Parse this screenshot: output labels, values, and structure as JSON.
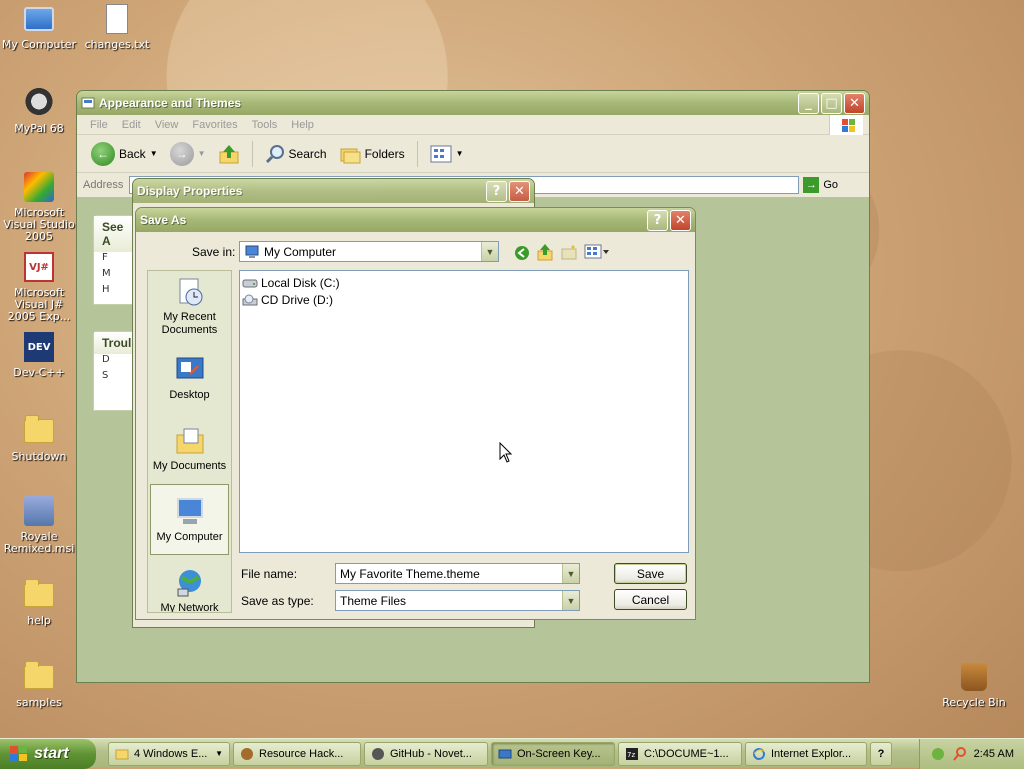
{
  "desktop": {
    "icons": [
      {
        "label": "My Computer",
        "icon": "computer-icon"
      },
      {
        "label": "changes.txt",
        "icon": "text-file-icon"
      },
      {
        "label": "MyPal 68",
        "icon": "browser-icon"
      },
      {
        "label": "Microsoft Visual Studio 2005",
        "icon": "visual-studio-icon"
      },
      {
        "label": "Microsoft Visual J# 2005 Exp...",
        "icon": "visual-j-icon"
      },
      {
        "label": "Dev-C++",
        "icon": "devcpp-icon"
      },
      {
        "label": "Shutdown",
        "icon": "folder-icon"
      },
      {
        "label": "Royale Remixed.msi",
        "icon": "installer-icon"
      },
      {
        "label": "help",
        "icon": "folder-icon"
      },
      {
        "label": "samples",
        "icon": "folder-icon"
      },
      {
        "label": "Recycle Bin",
        "icon": "recycle-bin-icon"
      }
    ]
  },
  "explorer": {
    "title": "Appearance and Themes",
    "menu": [
      "File",
      "Edit",
      "View",
      "Favorites",
      "Tools",
      "Help"
    ],
    "toolbar": {
      "back": "Back",
      "search": "Search",
      "folders": "Folders"
    },
    "address_label": "Address",
    "go_label": "Go",
    "side_panels": [
      {
        "heading": "See A",
        "rows": [
          "F",
          "M",
          "H"
        ]
      },
      {
        "heading": "Troul",
        "rows": [
          "D",
          "S"
        ]
      }
    ]
  },
  "display_properties": {
    "title": "Display Properties"
  },
  "save_as": {
    "title": "Save As",
    "save_in_label": "Save in:",
    "save_in_value": "My Computer",
    "places": [
      {
        "label": "My Recent Documents",
        "icon": "recent-documents-icon"
      },
      {
        "label": "Desktop",
        "icon": "desktop-icon"
      },
      {
        "label": "My Documents",
        "icon": "my-documents-icon"
      },
      {
        "label": "My Computer",
        "icon": "computer-icon",
        "active": true
      },
      {
        "label": "My Network",
        "icon": "network-icon"
      }
    ],
    "files": [
      {
        "label": "Local Disk (C:)",
        "icon": "hard-disk-icon"
      },
      {
        "label": "CD Drive (D:)",
        "icon": "cd-drive-icon"
      }
    ],
    "file_name_label": "File name:",
    "file_name_value": "My Favorite Theme.theme",
    "save_type_label": "Save as type:",
    "save_type_value": "Theme Files",
    "save_button": "Save",
    "cancel_button": "Cancel"
  },
  "taskbar": {
    "start_label": "start",
    "tasks": [
      {
        "label": "4 Windows E...",
        "active": false
      },
      {
        "label": "Resource Hack...",
        "active": false
      },
      {
        "label": "GitHub - Novet...",
        "active": false
      },
      {
        "label": "On-Screen Key...",
        "active": true
      },
      {
        "label": "C:\\DOCUME~1...",
        "active": false
      },
      {
        "label": "Internet Explor...",
        "active": false
      }
    ],
    "clock": "2:45 AM"
  },
  "colors": {
    "title_olive": "#a6b777",
    "close_red": "#c0452b",
    "start_green": "#5f9335"
  }
}
